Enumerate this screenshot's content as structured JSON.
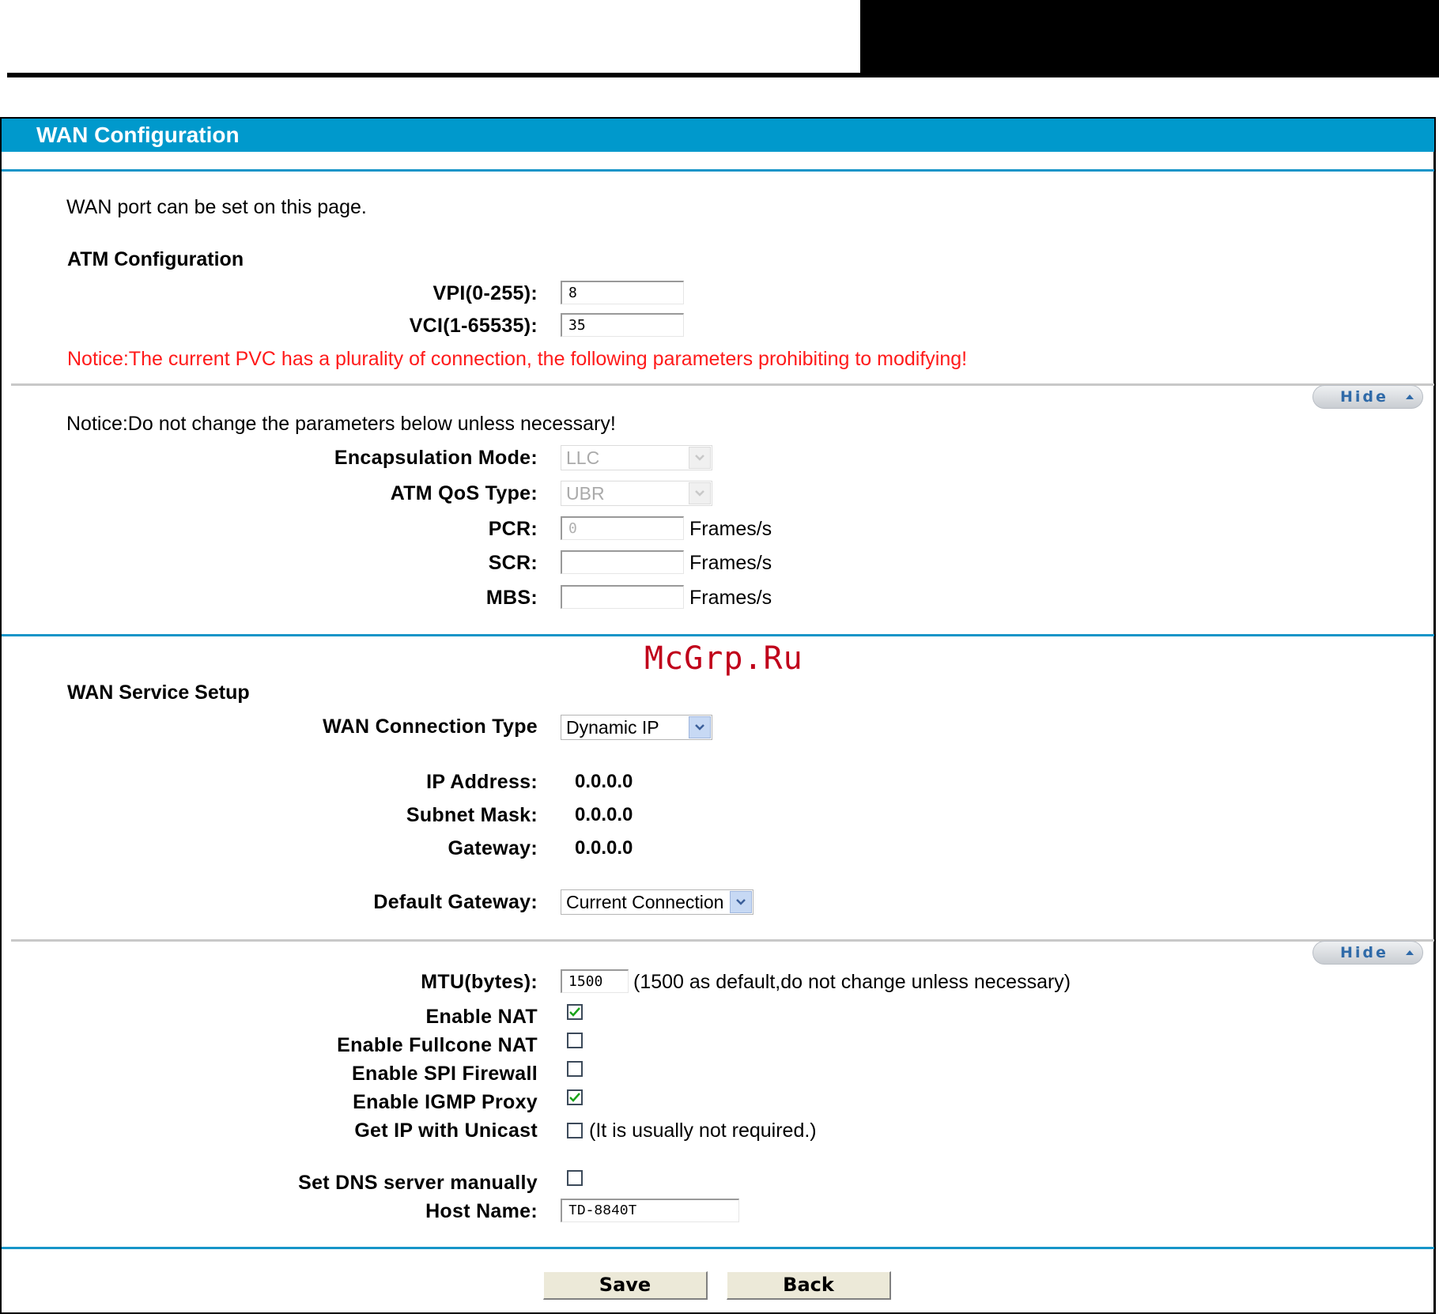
{
  "page": {
    "title": "WAN Configuration",
    "intro": "WAN port can be set on this page."
  },
  "atm": {
    "heading": "ATM Configuration",
    "vpi_label": "VPI(0-255):",
    "vpi_value": "8",
    "vci_label": "VCI(1-65535):",
    "vci_value": "35",
    "pvc_notice": "Notice:The current PVC has a plurality of connection, the following parameters prohibiting to modifying!"
  },
  "advanced_atm": {
    "hide_label": "Hide",
    "notice": "Notice:Do not change the parameters below unless necessary!",
    "encapsulation_label": "Encapsulation Mode:",
    "encapsulation_value": "LLC",
    "qos_label": "ATM QoS Type:",
    "qos_value": "UBR",
    "pcr_label": "PCR:",
    "pcr_value": "0",
    "scr_label": "SCR:",
    "scr_value": "",
    "mbs_label": "MBS:",
    "mbs_value": "",
    "unit": "Frames/s"
  },
  "watermark": "McGrp.Ru",
  "wan_service": {
    "heading": "WAN Service Setup",
    "connection_type_label": "WAN Connection Type",
    "connection_type_value": "Dynamic IP",
    "ip_label": "IP Address:",
    "ip_value": "0.0.0.0",
    "subnet_label": "Subnet Mask:",
    "subnet_value": "0.0.0.0",
    "gateway_label": "Gateway:",
    "gateway_value": "0.0.0.0",
    "default_gateway_label": "Default Gateway:",
    "default_gateway_value": "Current Connection"
  },
  "advanced_wan": {
    "hide_label": "Hide",
    "mtu_label": "MTU(bytes):",
    "mtu_value": "1500",
    "mtu_hint": "(1500 as default,do not change unless necessary)",
    "nat_label": "Enable NAT",
    "nat_checked": true,
    "fullcone_label": "Enable Fullcone NAT",
    "fullcone_checked": false,
    "spi_label": "Enable SPI Firewall",
    "spi_checked": false,
    "igmp_label": "Enable IGMP Proxy",
    "igmp_checked": true,
    "unicast_label": "Get IP with Unicast",
    "unicast_checked": false,
    "unicast_hint": "(It is usually not required.)",
    "dns_label": "Set DNS server manually",
    "dns_checked": false,
    "hostname_label": "Host Name:",
    "hostname_value": "TD-8840T"
  },
  "actions": {
    "save_label": "Save",
    "back_label": "Back"
  },
  "colors": {
    "title_bar": "#0099cc",
    "notice_red": "#ff1a1a",
    "check_green": "#1aa31a"
  }
}
